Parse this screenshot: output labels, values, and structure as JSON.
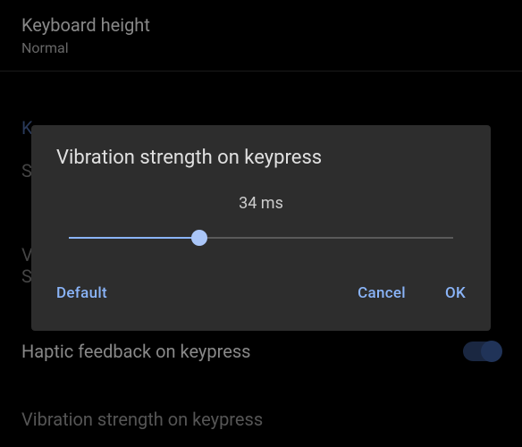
{
  "settings": {
    "keyboard_height": {
      "title": "Keyboard height",
      "value": "Normal"
    },
    "obscured_k": "K",
    "obscured_s": "S",
    "obscured_v": "V",
    "obscured_sy": "S",
    "haptic_feedback": {
      "label": "Haptic feedback on keypress"
    },
    "vibration_partial": "Vibration strength on keypress"
  },
  "dialog": {
    "title": "Vibration strength on keypress",
    "value": "34 ms",
    "buttons": {
      "default": "Default",
      "cancel": "Cancel",
      "ok": "OK"
    }
  }
}
